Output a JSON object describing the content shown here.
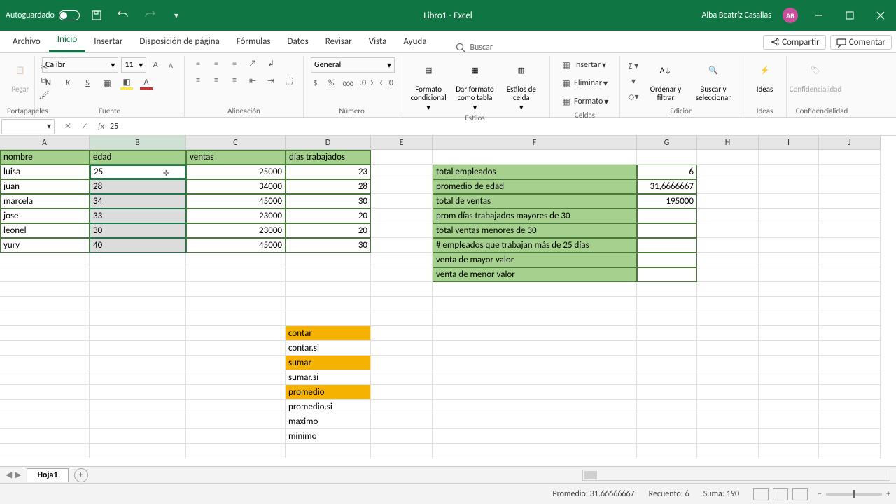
{
  "title": "Libro1  -  Excel",
  "user": {
    "name": "Alba Beatríz  Casallas",
    "initials": "AB"
  },
  "titlebar": {
    "autosave_label": "Autoguardado"
  },
  "menu": {
    "tabs": [
      "Archivo",
      "Inicio",
      "Insertar",
      "Disposición de página",
      "Fórmulas",
      "Datos",
      "Revisar",
      "Vista",
      "Ayuda"
    ],
    "search_placeholder": "Buscar",
    "share_label": "Compartir",
    "comment_label": "Comentar"
  },
  "ribbon": {
    "groups": {
      "clipboard": {
        "label": "Portapapeles",
        "paste": "Pegar"
      },
      "font": {
        "label": "Fuente",
        "font_name": "Calibri",
        "font_size": "11"
      },
      "align": {
        "label": "Alineación"
      },
      "number": {
        "label": "Número",
        "format": "General"
      },
      "styles": {
        "label": "Estilos",
        "cond": "Formato condicional",
        "table": "Dar formato como tabla",
        "cell": "Estilos de celda"
      },
      "cells": {
        "label": "Celdas",
        "insert": "Insertar",
        "delete": "Eliminar",
        "format": "Formato"
      },
      "editing": {
        "label": "Edición",
        "sort": "Ordenar y filtrar",
        "find": "Buscar y seleccionar"
      },
      "ideas": {
        "label": "Ideas",
        "btn": "Ideas"
      },
      "sens": {
        "label": "Confidencialidad",
        "btn": "Confidencialidad"
      }
    }
  },
  "formula_bar": {
    "value": "25"
  },
  "columns": [
    "A",
    "B",
    "C",
    "D",
    "E",
    "F",
    "G",
    "H",
    "I",
    "J"
  ],
  "table_headers": {
    "A": "nombre",
    "B": "edad",
    "C": "ventas",
    "D": "días trabajados"
  },
  "rows": [
    {
      "nombre": "luisa",
      "edad": "25",
      "ventas": "25000",
      "dias": "23"
    },
    {
      "nombre": "juan",
      "edad": "28",
      "ventas": "34000",
      "dias": "28"
    },
    {
      "nombre": "marcela",
      "edad": "34",
      "ventas": "45000",
      "dias": "30"
    },
    {
      "nombre": "jose",
      "edad": "33",
      "ventas": "23000",
      "dias": "20"
    },
    {
      "nombre": "leonel",
      "edad": "30",
      "ventas": "23000",
      "dias": "20"
    },
    {
      "nombre": "yury",
      "edad": "40",
      "ventas": "45000",
      "dias": "30"
    }
  ],
  "summary": [
    {
      "label": "total empleados",
      "value": "6"
    },
    {
      "label": "promedio de edad",
      "value": "31,6666667"
    },
    {
      "label": "total de ventas",
      "value": "195000"
    },
    {
      "label": "prom días trabajados mayores de 30",
      "value": ""
    },
    {
      "label": "total ventas menores de 30",
      "value": ""
    },
    {
      "label": "# empleados que trabajan más de 25 días",
      "value": ""
    },
    {
      "label": "venta de mayor valor",
      "value": ""
    },
    {
      "label": "venta de menor valor",
      "value": ""
    }
  ],
  "functions": [
    {
      "name": "contar",
      "hl": true
    },
    {
      "name": "contar.si",
      "hl": false
    },
    {
      "name": "sumar",
      "hl": true
    },
    {
      "name": "sumar.si",
      "hl": false
    },
    {
      "name": "promedio",
      "hl": true
    },
    {
      "name": "promedio.si",
      "hl": false
    },
    {
      "name": "maximo",
      "hl": false
    },
    {
      "name": "minimo",
      "hl": false
    }
  ],
  "sheet_tab": "Hoja1",
  "status_bar": {
    "promedio": "Promedio: 31.66666667",
    "recuento": "Recuento: 6",
    "suma": "Suma: 190"
  }
}
